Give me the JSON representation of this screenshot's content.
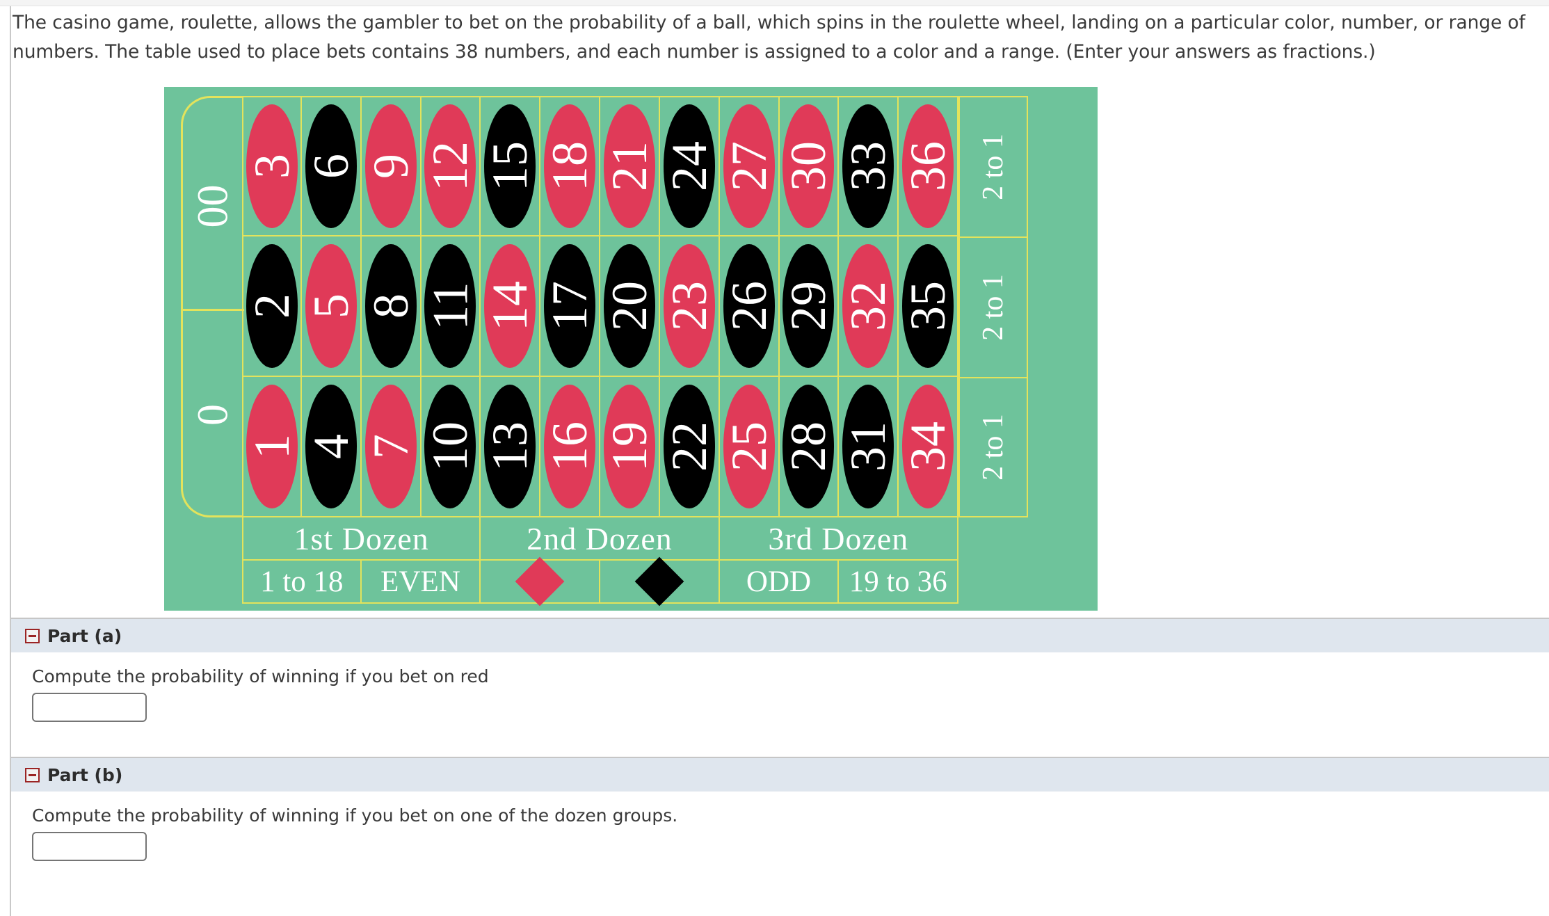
{
  "prompt": "The casino game, roulette, allows the gambler to bet on the probability of a ball, which spins in the roulette wheel, landing on a particular color, number, or range of numbers. The table used to place bets contains 38 numbers, and each number is assigned to a color and a range. (Enter your answers as fractions.)",
  "roulette_table": {
    "felt_color": "#6ec39b",
    "line_color": "#e3e35c",
    "red_color": "#e03a58",
    "black_color": "#000000",
    "text_color": "#ffffff",
    "zero_pockets": [
      {
        "label": "00",
        "color": "green"
      },
      {
        "label": "0",
        "color": "green"
      }
    ],
    "grid_rows": [
      [
        {
          "n": "3",
          "color": "red"
        },
        {
          "n": "6",
          "color": "black"
        },
        {
          "n": "9",
          "color": "red"
        },
        {
          "n": "12",
          "color": "red"
        },
        {
          "n": "15",
          "color": "black"
        },
        {
          "n": "18",
          "color": "red"
        },
        {
          "n": "21",
          "color": "red"
        },
        {
          "n": "24",
          "color": "black"
        },
        {
          "n": "27",
          "color": "red"
        },
        {
          "n": "30",
          "color": "red"
        },
        {
          "n": "33",
          "color": "black"
        },
        {
          "n": "36",
          "color": "red"
        }
      ],
      [
        {
          "n": "2",
          "color": "black"
        },
        {
          "n": "5",
          "color": "red"
        },
        {
          "n": "8",
          "color": "black"
        },
        {
          "n": "11",
          "color": "black"
        },
        {
          "n": "14",
          "color": "red"
        },
        {
          "n": "17",
          "color": "black"
        },
        {
          "n": "20",
          "color": "black"
        },
        {
          "n": "23",
          "color": "red"
        },
        {
          "n": "26",
          "color": "black"
        },
        {
          "n": "29",
          "color": "black"
        },
        {
          "n": "32",
          "color": "red"
        },
        {
          "n": "35",
          "color": "black"
        }
      ],
      [
        {
          "n": "1",
          "color": "red"
        },
        {
          "n": "4",
          "color": "black"
        },
        {
          "n": "7",
          "color": "red"
        },
        {
          "n": "10",
          "color": "black"
        },
        {
          "n": "13",
          "color": "black"
        },
        {
          "n": "16",
          "color": "red"
        },
        {
          "n": "19",
          "color": "red"
        },
        {
          "n": "22",
          "color": "black"
        },
        {
          "n": "25",
          "color": "red"
        },
        {
          "n": "28",
          "color": "black"
        },
        {
          "n": "31",
          "color": "black"
        },
        {
          "n": "34",
          "color": "red"
        }
      ]
    ],
    "column_bets": [
      "2 to 1",
      "2 to 1",
      "2 to 1"
    ],
    "dozen_bets": [
      "1st  Dozen",
      "2nd  Dozen",
      "3rd  Dozen"
    ],
    "outside_bets": [
      {
        "label": "1 to 18",
        "type": "text"
      },
      {
        "label": "EVEN",
        "type": "text"
      },
      {
        "label": "red-diamond",
        "type": "diamond",
        "color": "red"
      },
      {
        "label": "black-diamond",
        "type": "diamond",
        "color": "black"
      },
      {
        "label": "ODD",
        "type": "text"
      },
      {
        "label": "19 to 36",
        "type": "text"
      }
    ]
  },
  "parts": [
    {
      "title": "Part (a)",
      "question": "Compute the probability of winning if you bet on red",
      "answer_value": "",
      "answer_placeholder": ""
    },
    {
      "title": "Part (b)",
      "question": "Compute the probability of winning if you bet on one of the dozen groups.",
      "answer_value": "",
      "answer_placeholder": ""
    }
  ]
}
